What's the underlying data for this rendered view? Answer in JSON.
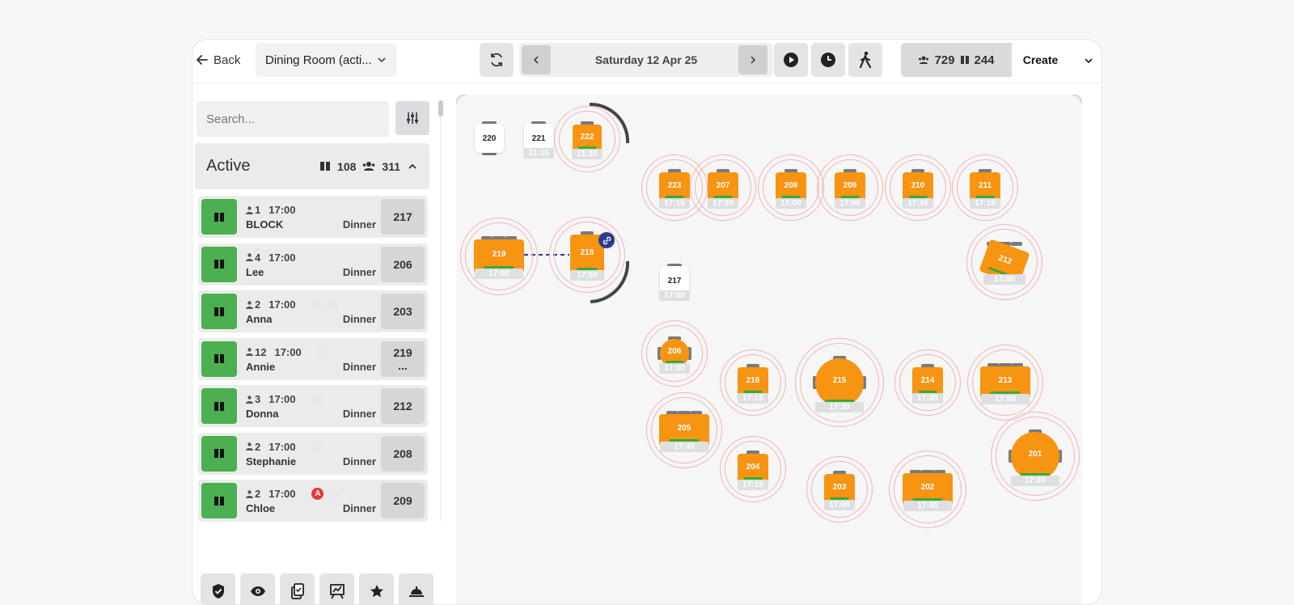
{
  "topbar": {
    "back_label": "Back",
    "room_label": "Dining Room (acti...",
    "date_label": "Saturday 12 Apr 25",
    "guests_count": "729",
    "bookings_count": "244",
    "create_label": "Create"
  },
  "sidebar": {
    "search_placeholder": "Search...",
    "active_title": "Active",
    "active_bookings": "108",
    "active_guests": "311",
    "reservations": [
      {
        "covers": "1",
        "time": "17:00",
        "name": "BLOCK",
        "meal": "Dinner",
        "table": "217",
        "table2": ""
      },
      {
        "covers": "4",
        "time": "17:00",
        "name": "Lee",
        "meal": "Dinner",
        "table": "206",
        "table2": ""
      },
      {
        "covers": "2",
        "time": "17:00",
        "name": "Anna",
        "meal": "Dinner",
        "table": "203",
        "table2": ""
      },
      {
        "covers": "12",
        "time": "17:00",
        "name": "Annie",
        "meal": "Dinner",
        "table": "219",
        "table2": "..."
      },
      {
        "covers": "3",
        "time": "17:00",
        "name": "Donna",
        "meal": "Dinner",
        "table": "212",
        "table2": ""
      },
      {
        "covers": "2",
        "time": "17:00",
        "name": "Stephanie",
        "meal": "Dinner",
        "table": "208",
        "table2": ""
      },
      {
        "covers": "2",
        "time": "17:00",
        "name": "Chloe",
        "meal": "Dinner",
        "table": "209",
        "table2": ""
      }
    ],
    "alert_badge": "A"
  },
  "floor": {
    "tables": [
      {
        "id": "220",
        "time": "",
        "state": "empty"
      },
      {
        "id": "221",
        "time": "21:15",
        "state": "empty"
      },
      {
        "id": "222",
        "time": "21:30",
        "state": "seated"
      },
      {
        "id": "223",
        "time": "17:15",
        "state": "seated"
      },
      {
        "id": "207",
        "time": "17:30",
        "state": "seated"
      },
      {
        "id": "208",
        "time": "17:00",
        "state": "seated"
      },
      {
        "id": "209",
        "time": "17:00",
        "state": "seated"
      },
      {
        "id": "210",
        "time": "17:45",
        "state": "seated"
      },
      {
        "id": "211",
        "time": "17:15",
        "state": "seated"
      },
      {
        "id": "219",
        "time": "17:00",
        "state": "seated"
      },
      {
        "id": "218",
        "time": "17:00",
        "state": "seated"
      },
      {
        "id": "217",
        "time": "17:00",
        "state": "empty"
      },
      {
        "id": "212",
        "time": "17:00",
        "state": "seated"
      },
      {
        "id": "206",
        "time": "17:00",
        "state": "seated"
      },
      {
        "id": "216",
        "time": "17:15",
        "state": "seated"
      },
      {
        "id": "215",
        "time": "17:30",
        "state": "seated"
      },
      {
        "id": "214",
        "time": "17:30",
        "state": "seated"
      },
      {
        "id": "213",
        "time": "17:00",
        "state": "seated"
      },
      {
        "id": "205",
        "time": "17:45",
        "state": "seated"
      },
      {
        "id": "204",
        "time": "17:15",
        "state": "seated"
      },
      {
        "id": "203",
        "time": "17:00",
        "state": "seated"
      },
      {
        "id": "202",
        "time": "17:45",
        "state": "seated"
      },
      {
        "id": "201",
        "time": "17:30",
        "state": "seated"
      }
    ]
  },
  "colors": {
    "accent": "#f79412",
    "status_green": "#4caf50",
    "ring": "#f3b5b0"
  }
}
